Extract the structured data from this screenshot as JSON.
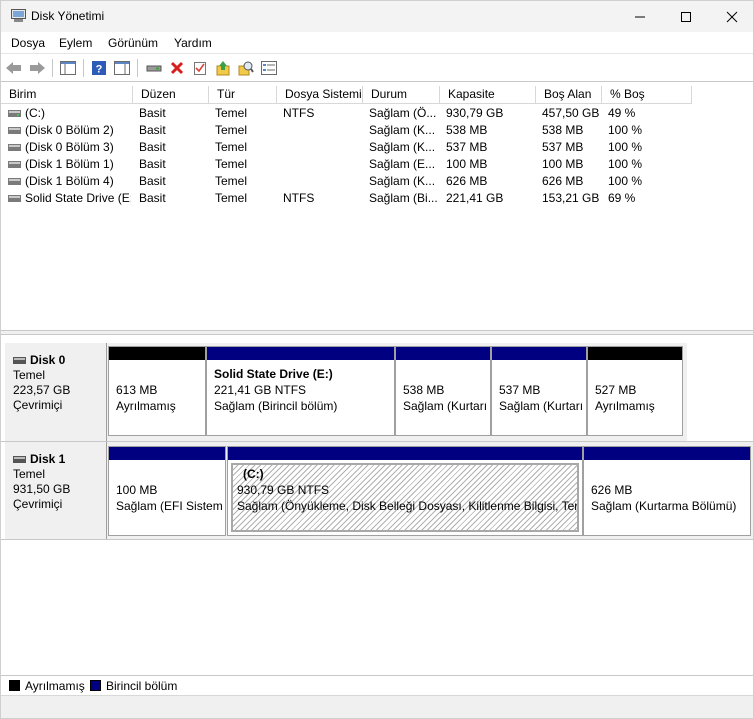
{
  "window": {
    "title": "Disk Yönetimi"
  },
  "menu": [
    "Dosya",
    "Eylem",
    "Görünüm",
    "Yardım"
  ],
  "columns": [
    "Birim",
    "Düzen",
    "Tür",
    "Dosya Sistemi",
    "Durum",
    "Kapasite",
    "Boş Alan",
    "% Boş"
  ],
  "volumes": [
    {
      "name": "(C:)",
      "layout": "Basit",
      "type": "Temel",
      "fs": "NTFS",
      "status": "Sağlam (Ö...",
      "capacity": "930,79 GB",
      "free": "457,50 GB",
      "pct": "49 %"
    },
    {
      "name": "(Disk 0 Bölüm 2)",
      "layout": "Basit",
      "type": "Temel",
      "fs": "",
      "status": "Sağlam (K...",
      "capacity": "538 MB",
      "free": "538 MB",
      "pct": "100 %"
    },
    {
      "name": "(Disk 0 Bölüm 3)",
      "layout": "Basit",
      "type": "Temel",
      "fs": "",
      "status": "Sağlam (K...",
      "capacity": "537 MB",
      "free": "537 MB",
      "pct": "100 %"
    },
    {
      "name": "(Disk 1 Bölüm 1)",
      "layout": "Basit",
      "type": "Temel",
      "fs": "",
      "status": "Sağlam (E...",
      "capacity": "100 MB",
      "free": "100 MB",
      "pct": "100 %"
    },
    {
      "name": "(Disk 1 Bölüm 4)",
      "layout": "Basit",
      "type": "Temel",
      "fs": "",
      "status": "Sağlam (K...",
      "capacity": "626 MB",
      "free": "626 MB",
      "pct": "100 %"
    },
    {
      "name": "Solid State Drive (E:)",
      "layout": "Basit",
      "type": "Temel",
      "fs": "NTFS",
      "status": "Sağlam (Bi...",
      "capacity": "221,41 GB",
      "free": "153,21 GB",
      "pct": "69 %"
    }
  ],
  "disks": [
    {
      "name": "Disk 0",
      "type": "Temel",
      "size": "223,57 GB",
      "state": "Çevrimiçi",
      "partitions": [
        {
          "kind": "unallocated",
          "title": "",
          "line1": "613 MB",
          "line2": "Ayrılmamış"
        },
        {
          "kind": "primary",
          "title": "Solid State Drive  (E:)",
          "line1": "221,41 GB NTFS",
          "line2": "Sağlam (Birincil bölüm)"
        },
        {
          "kind": "primary",
          "title": "",
          "line1": "538 MB",
          "line2": "Sağlam (Kurtarı"
        },
        {
          "kind": "primary",
          "title": "",
          "line1": "537 MB",
          "line2": "Sağlam (Kurtarı"
        },
        {
          "kind": "unallocated",
          "title": "",
          "line1": "527 MB",
          "line2": "Ayrılmamış"
        }
      ]
    },
    {
      "name": "Disk 1",
      "type": "Temel",
      "size": "931,50 GB",
      "state": "Çevrimiçi",
      "partitions": [
        {
          "kind": "primary",
          "title": "",
          "line1": "100 MB",
          "line2": "Sağlam (EFI Sistem"
        },
        {
          "kind": "primary",
          "title": "(C:)",
          "line1": "930,79 GB NTFS",
          "line2": "Sağlam (Önyükleme, Disk Belleği Dosyası, Kilitlenme Bilgisi, Temel Veri Bölümü)"
        },
        {
          "kind": "primary",
          "title": "",
          "line1": "626 MB",
          "line2": "Sağlam (Kurtarma Bölümü)"
        }
      ]
    }
  ],
  "legend": [
    {
      "label": "Ayrılmamış",
      "color": "#000000"
    },
    {
      "label": "Birincil bölüm",
      "color": "#000080"
    }
  ],
  "colors": {
    "unallocated": "#000000",
    "primary": "#000080"
  }
}
